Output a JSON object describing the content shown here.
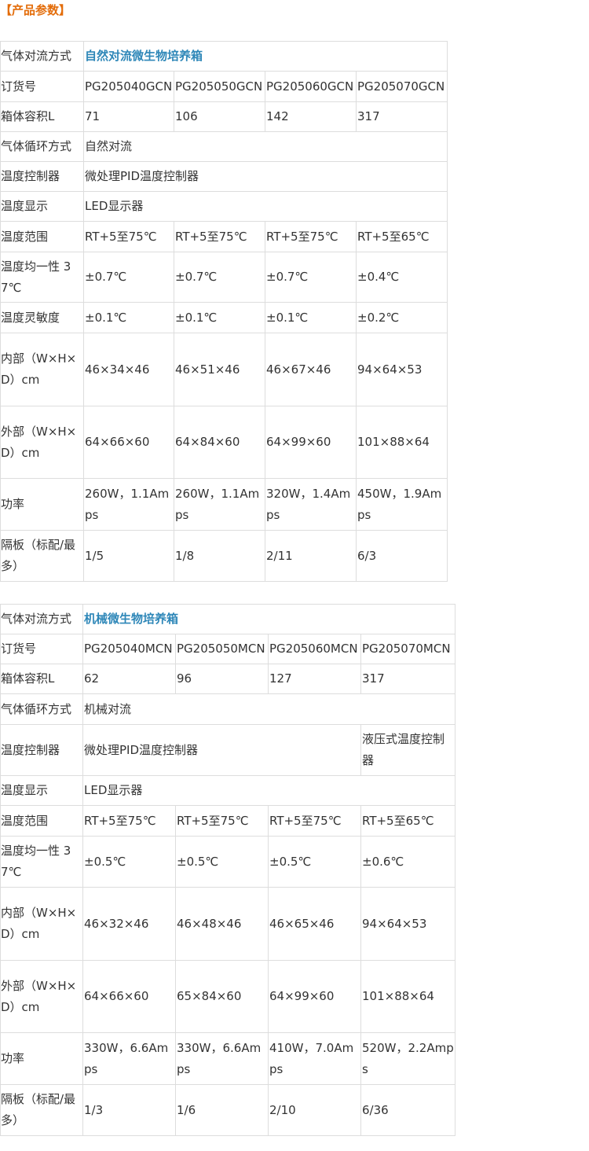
{
  "heading": "【产品参数】",
  "tables": [
    {
      "rows": [
        {
          "label": "气体对流方式",
          "span": "自然对流微生物培养箱",
          "title": true
        },
        {
          "label": "订货号",
          "cells": [
            "PG205040GCN",
            "PG205050GCN",
            "PG205060GCN",
            "PG205070GCN"
          ]
        },
        {
          "label": "箱体容积L",
          "cells": [
            "71",
            "106",
            "142",
            "317"
          ]
        },
        {
          "label": "气体循环方式",
          "span": "自然对流"
        },
        {
          "label": "温度控制器",
          "span": "微处理PID温度控制器"
        },
        {
          "label": "温度显示",
          "span": "LED显示器"
        },
        {
          "label": "温度范围",
          "cells": [
            "RT+5至75℃",
            "RT+5至75℃",
            "RT+5至75℃",
            "RT+5至65℃"
          ]
        },
        {
          "label": "温度均一性 37℃",
          "cells": [
            "±0.7℃",
            "±0.7℃",
            "±0.7℃",
            "±0.4℃"
          ]
        },
        {
          "label": "温度灵敏度",
          "cells": [
            "±0.1℃",
            "±0.1℃",
            "±0.1℃",
            "±0.2℃"
          ]
        },
        {
          "label": "内部（W×H×D）cm",
          "cells": [
            "46×34×46",
            "46×51×46",
            "46×67×46",
            "94×64×53"
          ]
        },
        {
          "label": "外部（W×H×D）cm",
          "cells": [
            "64×66×60",
            "64×84×60",
            "64×99×60",
            "101×88×64"
          ]
        },
        {
          "label": "功率",
          "cells": [
            "260W，1.1Amps",
            "260W，1.1Amps",
            "320W，1.4Amps",
            "450W，1.9Amps"
          ]
        },
        {
          "label": "隔板（标配/最多）",
          "cells": [
            "1/5",
            "1/8",
            "2/11",
            "6/3"
          ]
        }
      ]
    },
    {
      "rows": [
        {
          "label": "气体对流方式",
          "span": "机械微生物培养箱",
          "title": true
        },
        {
          "label": "订货号",
          "cells": [
            "PG205040MCN",
            "PG205050MCN",
            "PG205060MCN",
            "PG205070MCN"
          ]
        },
        {
          "label": "箱体容积L",
          "cells": [
            "62",
            "96",
            "127",
            "317"
          ]
        },
        {
          "label": "气体循环方式",
          "span": "机械对流"
        },
        {
          "label": "温度控制器",
          "span3": "微处理PID温度控制器",
          "last": "液压式温度控制器"
        },
        {
          "label": "温度显示",
          "span": "LED显示器"
        },
        {
          "label": "温度范围",
          "cells": [
            "RT+5至75℃",
            "RT+5至75℃",
            "RT+5至75℃",
            "RT+5至65℃"
          ]
        },
        {
          "label": "温度均一性 37℃",
          "cells": [
            "±0.5℃",
            "±0.5℃",
            "±0.5℃",
            "±0.6℃"
          ]
        },
        {
          "label": "内部（W×H×D）cm",
          "cells": [
            "46×32×46",
            "46×48×46",
            "46×65×46",
            "94×64×53"
          ]
        },
        {
          "label": "外部（W×H×D）cm",
          "cells": [
            "64×66×60",
            "65×84×60",
            "64×99×60",
            "101×88×64"
          ]
        },
        {
          "label": "功率",
          "cells": [
            "330W，6.6Amps",
            "330W，6.6Amps",
            "410W，7.0Amps",
            "520W，2.2Amps"
          ]
        },
        {
          "label": "隔板（标配/最多）",
          "cells": [
            "1/3",
            "1/6",
            "2/10",
            "6/36"
          ]
        }
      ]
    }
  ]
}
